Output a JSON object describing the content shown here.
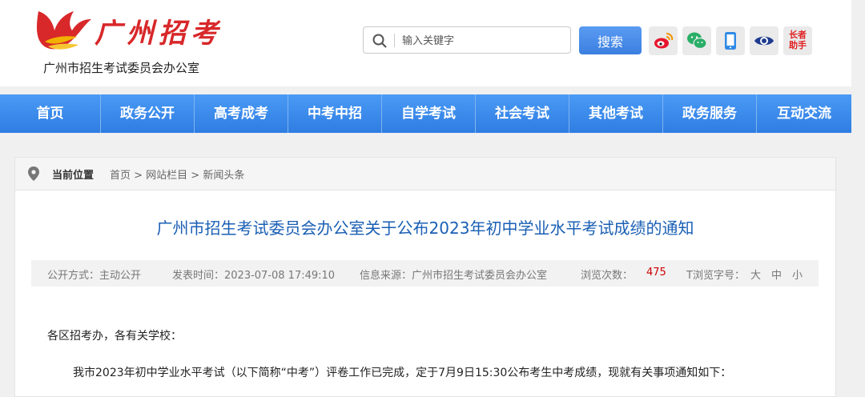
{
  "header": {
    "logo_script": "广州招考",
    "logo_subtitle": "广州市招生考试委员会办公室",
    "search_placeholder": "输入关键字",
    "search_button": "搜索",
    "icons": [
      "weibo-icon",
      "wechat-icon",
      "mobile-icon",
      "eye-icon",
      "zhushou-icon"
    ],
    "zhushou_label": "长者助手",
    "accent_red": "#d8282a"
  },
  "nav": {
    "color": "#3a8ae8",
    "items": [
      "首页",
      "政务公开",
      "高考成考",
      "中考中招",
      "自学考试",
      "社会考试",
      "其他考试",
      "政务服务",
      "互动交流"
    ]
  },
  "breadcrumb": {
    "label": "当前位置",
    "trail": "首页 > 网站栏目 > 新闻头条"
  },
  "article": {
    "title": "广州市招生考试委员会办公室关于公布2023年初中学业水平考试成绩的通知",
    "title_color": "#1a5fb4",
    "meta": {
      "open_mode": "公开方式：主动公开",
      "publish_time": "发表时间：2023-07-08 17:49:10",
      "source": "信息来源：广州市招生考试委员会办公室",
      "views_label": "浏览次数：",
      "views": "475",
      "font_label": "T浏览字号：",
      "font_large": "大",
      "font_medium": "中",
      "font_small": "小"
    },
    "greeting": "各区招考办，各有关学校：",
    "paragraph1": "我市2023年初中学业水平考试（以下简称“中考”）评卷工作已完成，定于7月9日15:30公布考生中考成绩，现就有关事项通知如下："
  }
}
